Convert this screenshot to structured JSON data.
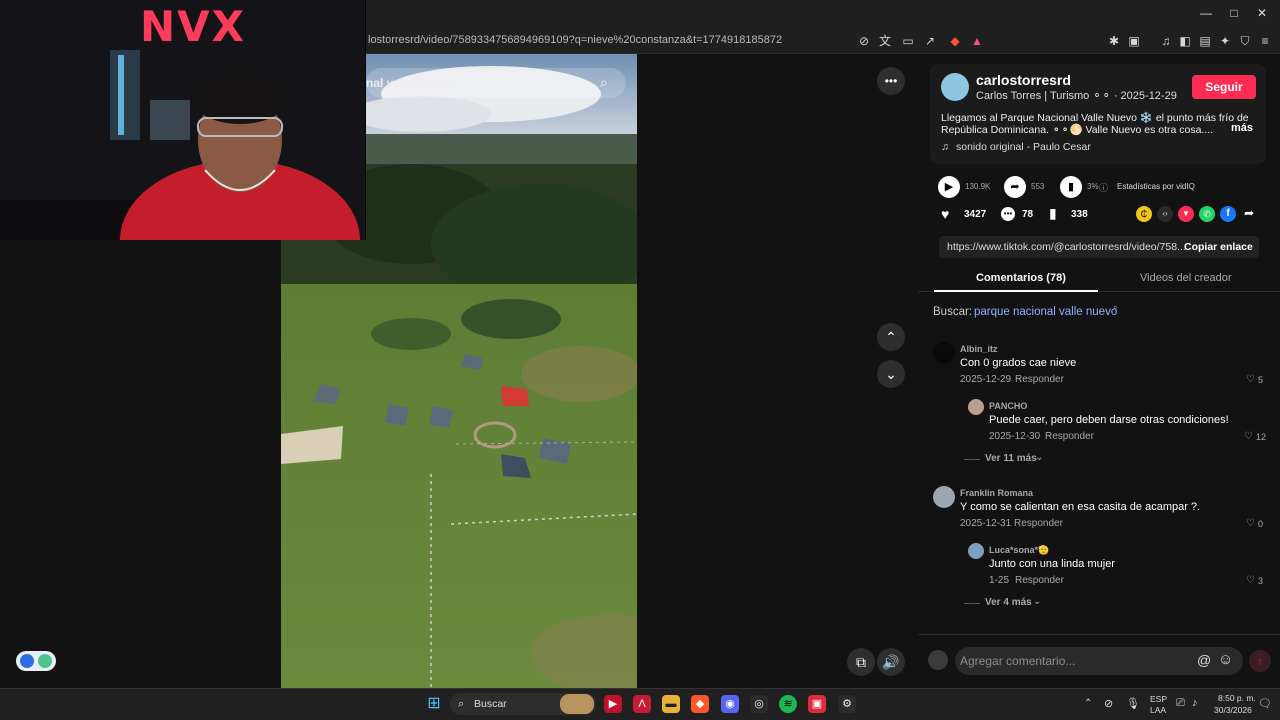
{
  "browser": {
    "url": "lostorresrd/video/7589334756894969109?q=nieve%20constanza&t=1774918185872",
    "window_controls": [
      "—",
      "□",
      "✕"
    ]
  },
  "webcam": {
    "sign_text": "NVX"
  },
  "video": {
    "search_text": "nal valle nuevo",
    "more_label": "•••"
  },
  "creator": {
    "username": "carlostorresrd",
    "subtitle": "Carlos Torres | Turismo ⚬⚬ · 2025-12-29",
    "follow_label": "Seguir",
    "description_line1": "Llegamos al Parque Nacional Valle Nuevo ❄️ el punto más frío de",
    "description_line2": "República Dominicana. ⚬⚬🌕 Valle Nuevo es otra cosa....",
    "more_label": "más",
    "sound": "sonido original - Paulo Cesar"
  },
  "stats": {
    "plays": "130.9K",
    "shares": "553",
    "percent": "3%",
    "stats_label": "Estadísticas por vidIQ",
    "likes": "3427",
    "comments": "78",
    "saves": "338"
  },
  "share": {
    "link": "https://www.tiktok.com/@carlostorresrd/video/758...",
    "copy_label": "Copiar enlace"
  },
  "tabs": [
    "Comentarios (78)",
    "Videos del creador"
  ],
  "search_suggestion": {
    "prefix": "Buscar:",
    "term": "parque nacional valle nuevo"
  },
  "comments": [
    {
      "user": "Albin_itz",
      "text": "Con 0 grados cae nieve",
      "date": "2025-12-29",
      "reply": "Responder",
      "likes": "5"
    },
    {
      "user": "PANCHO",
      "text": "Puede caer, pero deben darse otras condiciones!",
      "date": "2025-12-30",
      "reply": "Responder",
      "likes": "12"
    },
    {
      "user": "Franklin Romana",
      "text": "Y como se calientan en esa casita de acampar ?.",
      "date": "2025-12-31",
      "reply": "Responder",
      "likes": "0"
    },
    {
      "user": "Luca*sona*🫡",
      "text": "Junto con una linda mujer",
      "date": "1-25",
      "reply": "Responder",
      "likes": "3"
    }
  ],
  "view_more": [
    "Ver 11 más",
    "Ver 4 más"
  ],
  "comment_input": {
    "placeholder": "Agregar comentario..."
  },
  "taskbar": {
    "search": "Buscar",
    "lang": "ESP",
    "lang2": "LAA",
    "time": "8:50 p. m.",
    "date": "30/3/2026"
  }
}
